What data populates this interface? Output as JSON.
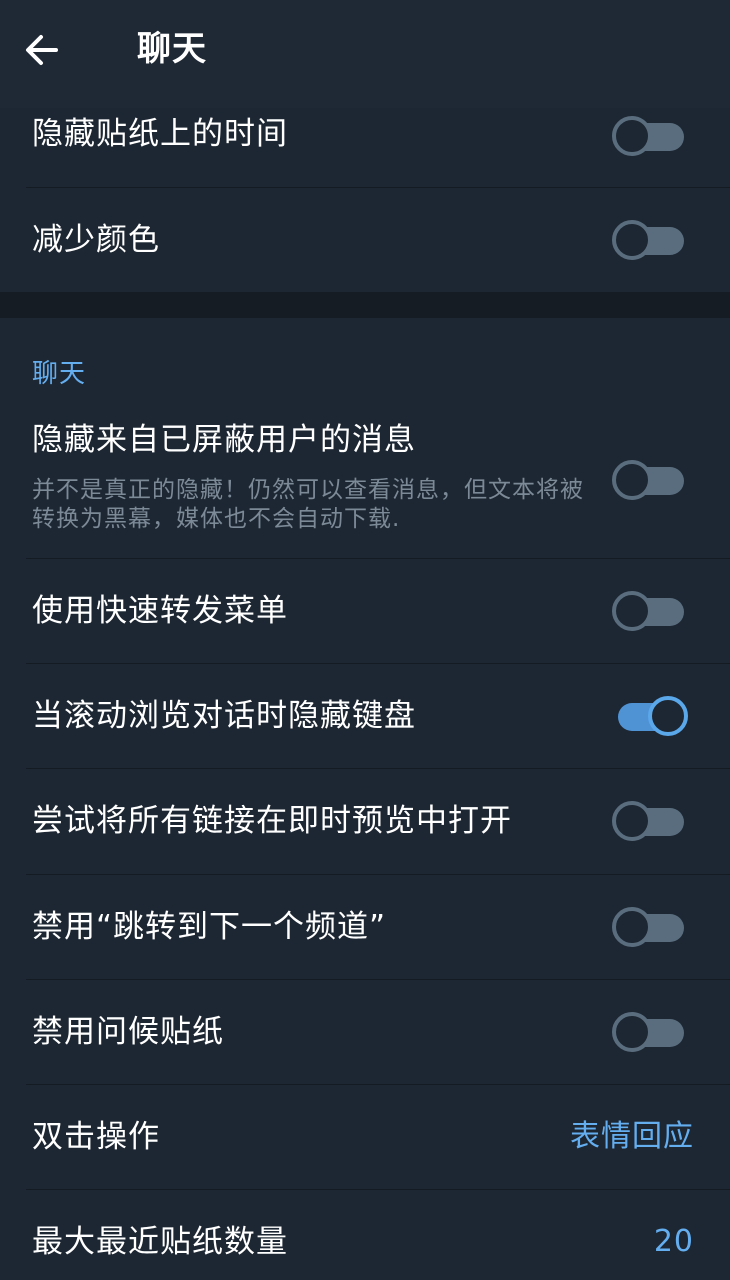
{
  "header": {
    "title": "聊天"
  },
  "top_group": [
    {
      "label": "隐藏贴纸上的时间",
      "toggle": false
    },
    {
      "label": "减少颜色",
      "toggle": false
    }
  ],
  "chat_section": {
    "header": "聊天",
    "items": [
      {
        "label": "隐藏来自已屏蔽用户的消息",
        "sub": "并不是真正的隐藏！仍然可以查看消息，但文本将被转换为黑幕，媒体也不会自动下载.",
        "toggle": false
      },
      {
        "label": "使用快速转发菜单",
        "toggle": false
      },
      {
        "label": "当滚动浏览对话时隐藏键盘",
        "toggle": true
      },
      {
        "label": "尝试将所有链接在即时预览中打开",
        "toggle": false
      },
      {
        "label": "禁用“跳转到下一个频道”",
        "toggle": false
      },
      {
        "label": "禁用问候贴纸",
        "toggle": false
      },
      {
        "label": "双击操作",
        "value": "表情回应"
      },
      {
        "label": "最大最近贴纸数量",
        "value": "20"
      }
    ]
  },
  "colors": {
    "background": "#1d2733",
    "accent": "#64aef0",
    "toggle_off": "#5a6d7e",
    "toggle_on": "#4f93d5"
  },
  "icons": {
    "back": "arrow-left-icon"
  }
}
